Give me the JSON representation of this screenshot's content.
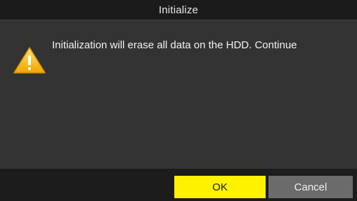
{
  "dialog": {
    "title": "Initialize",
    "message": "Initialization will erase all data on the HDD. Continue",
    "icon": "warning-icon",
    "ok_label": "OK",
    "cancel_label": "Cancel"
  },
  "colors": {
    "titlebar_bg": "#1b1b1b",
    "body_bg": "#333333",
    "footer_bg": "#1c1c1c",
    "ok_button_bg": "#fff200",
    "cancel_button_bg": "#6b6b6b",
    "warning_icon": "#f5b800"
  }
}
